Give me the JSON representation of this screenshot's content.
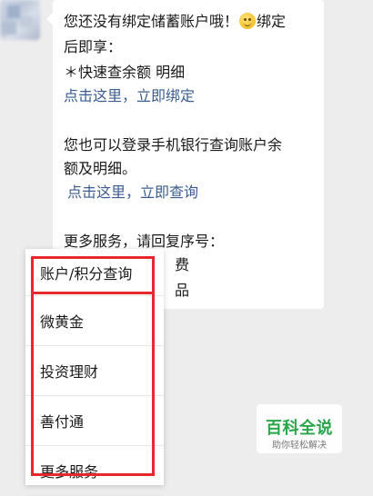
{
  "chat": {
    "lines": [
      "您还没有绑定储蓄账户哦！",
      "绑定",
      "后即享：",
      "＊快速查余额 明细",
      "点击这里，立即绑定",
      "您也可以登录手机银行查询账户余",
      "额及明细。",
      "点击这里，立即查询",
      "更多服务，请回复序号：",
      "费",
      "品"
    ],
    "emoji": "smiley-emoji"
  },
  "menu": {
    "items": [
      "账户/积分查询",
      "微黄金",
      "投资理财",
      "善付通",
      "更多服务"
    ]
  },
  "watermark": {
    "title": "百科全说",
    "subtitle": "助你轻松解决"
  },
  "colors": {
    "link": "#3a5c8f",
    "highlight": "#e8262d",
    "brand": "#2aa64a"
  }
}
